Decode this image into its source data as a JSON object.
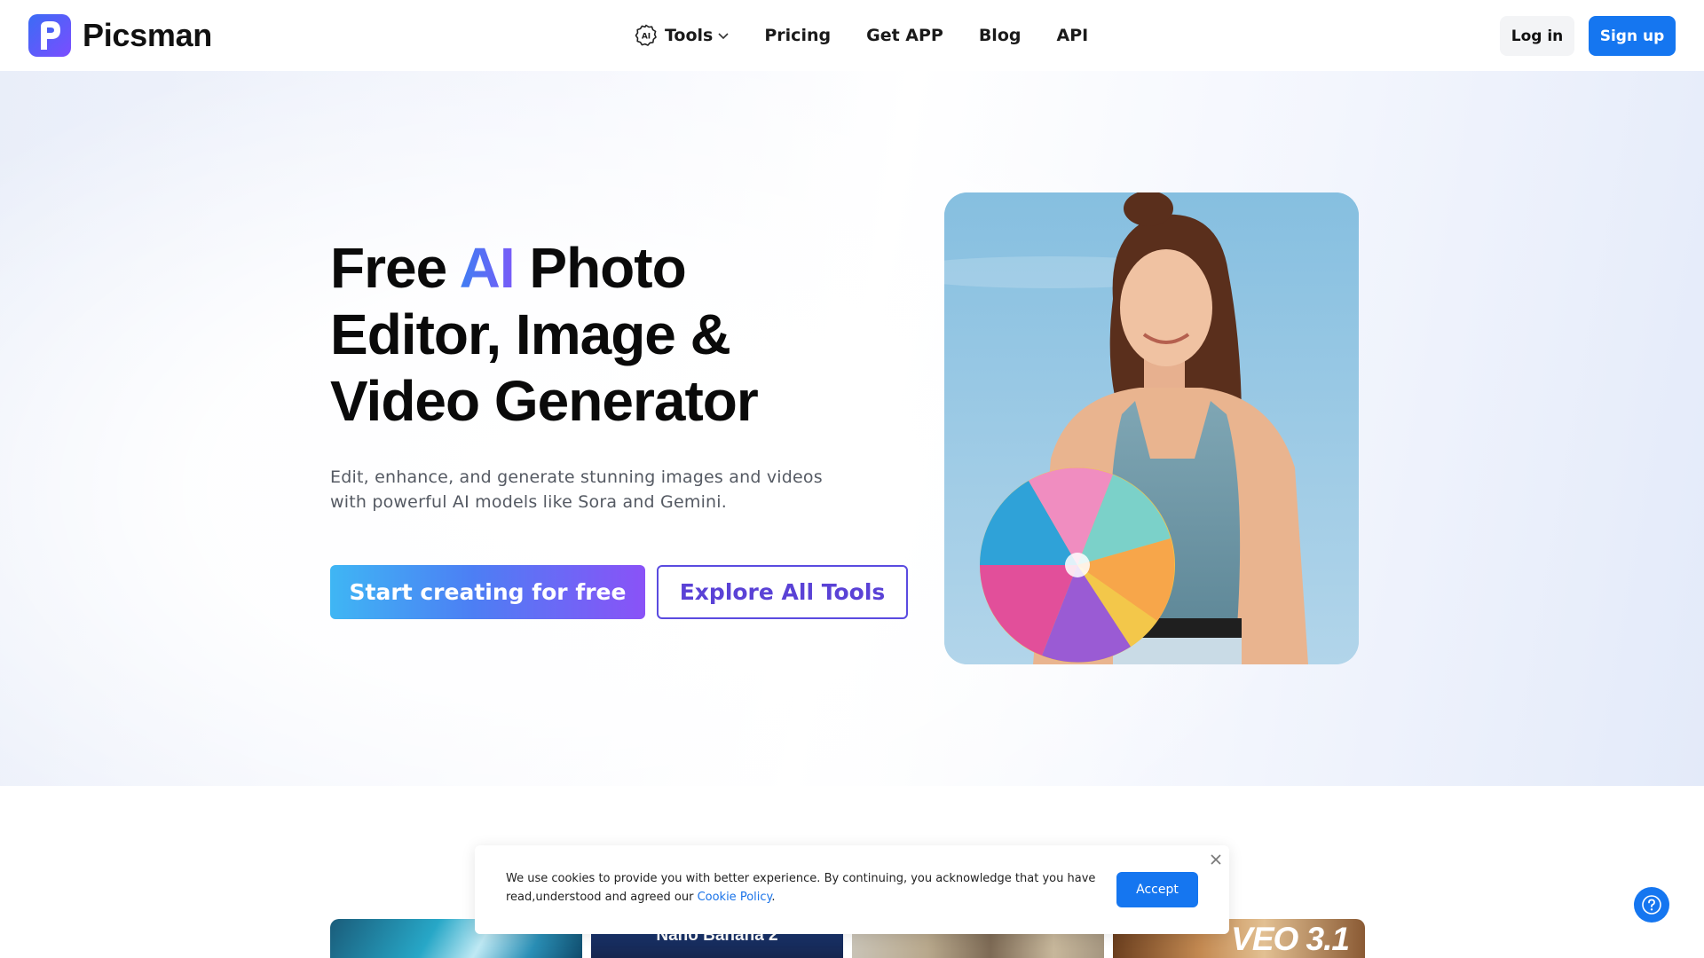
{
  "brand": {
    "name": "Picsman",
    "logo_letter": "P"
  },
  "nav": {
    "tools_label": "Tools",
    "tools_icon_text": "AI",
    "items": [
      "Pricing",
      "Get APP",
      "Blog",
      "API"
    ]
  },
  "auth": {
    "login_label": "Log in",
    "signup_label": "Sign up"
  },
  "hero": {
    "title_part1": "Free ",
    "title_accent": "AI",
    "title_part2": " Photo",
    "title_line2": "Editor, Image &",
    "title_line3": "Video Generator",
    "subtitle": "Edit, enhance, and generate stunning images and videos with powerful AI models like Sora and Gemini.",
    "cta_primary": "Start creating for free",
    "cta_secondary": "Explore All Tools"
  },
  "thumbnails": [
    {
      "label": ""
    },
    {
      "label": "Nano Banana 2"
    },
    {
      "label": ""
    },
    {
      "label": "VEO 3.1"
    }
  ],
  "cookie": {
    "text": "We use cookies to provide you with better experience. By continuing, you acknowledge that you have read,understood and agreed our ",
    "link_text": "Cookie Policy",
    "suffix": ".",
    "accept_label": "Accept"
  },
  "colors": {
    "primary": "#1576f0",
    "accent_gradient_start": "#3f7ef2",
    "accent_gradient_end": "#7a5af8"
  },
  "icons": {
    "tools": "ai-chip-icon",
    "dropdown": "chevron-down-icon",
    "close": "close-icon",
    "help": "question-circle-icon"
  }
}
